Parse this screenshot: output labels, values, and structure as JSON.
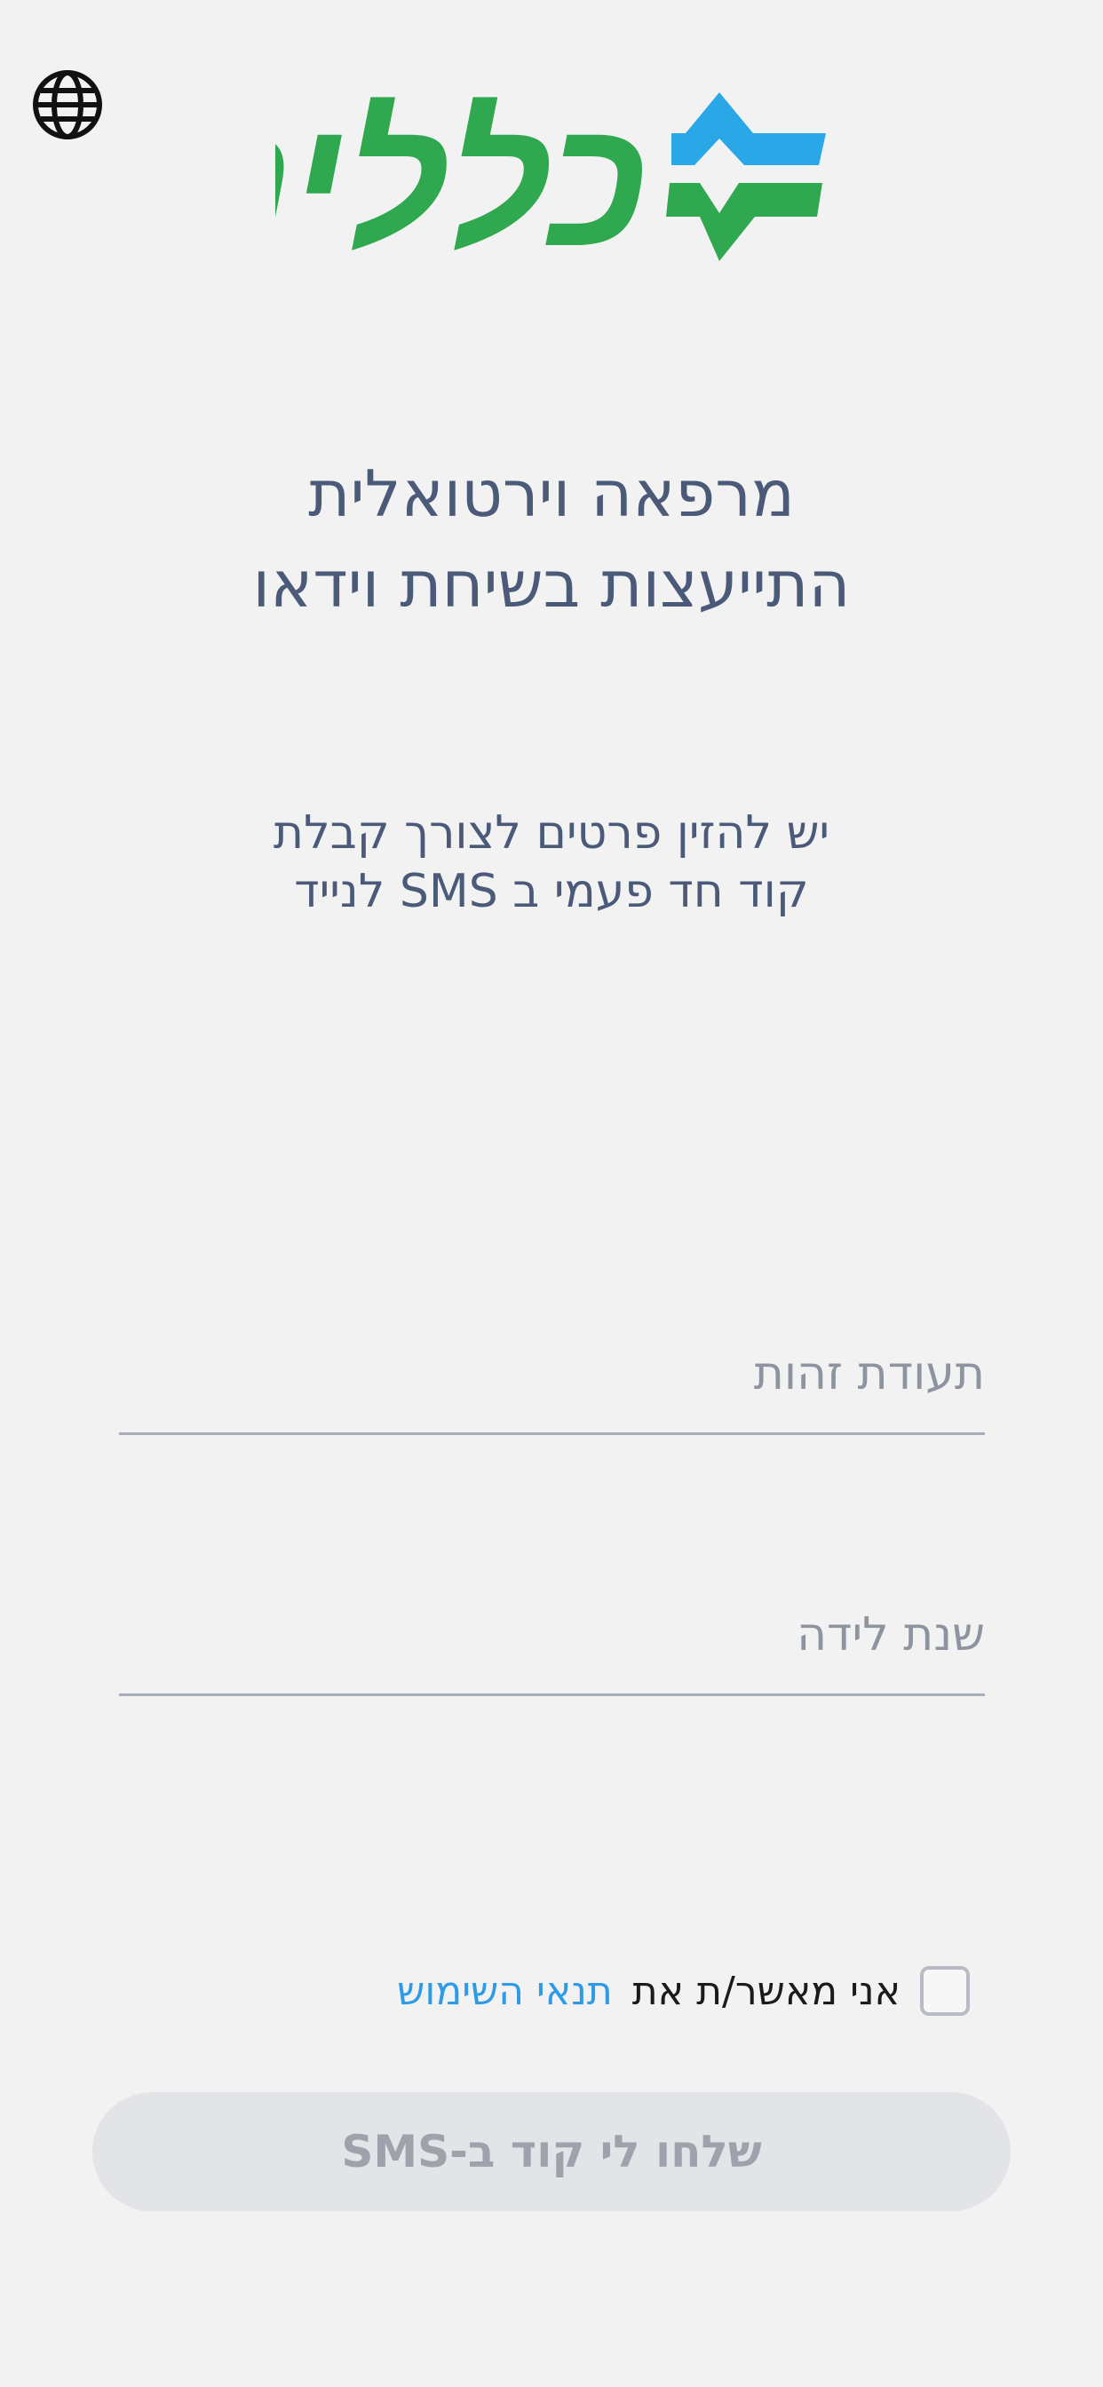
{
  "header": {
    "language_icon": "globe-icon",
    "logo_text": "כללית",
    "logo_colors": {
      "text": "#2fa84f",
      "mark_top": "#2aa7e6",
      "mark_bottom": "#2fa84f"
    }
  },
  "main": {
    "title_line1": "מרפאה וירטואלית",
    "title_line2": "התייעצות בשיחת וידאו",
    "subtitle_line1": "יש להזין פרטים לצורך קבלת",
    "subtitle_line2": "קוד חד פעמי ב SMS לנייד"
  },
  "form": {
    "id_field": {
      "placeholder": "תעודת זהות",
      "value": ""
    },
    "birth_year_field": {
      "placeholder": "שנת לידה",
      "value": ""
    },
    "terms": {
      "checked": false,
      "text": "אני מאשר/ת את",
      "link": "תנאי השימוש"
    },
    "submit_label": "שלחו לי קוד ב-SMS"
  },
  "colors": {
    "background": "#f2f2f2",
    "text_primary": "#4b5a78",
    "link": "#2f9ae6",
    "button_bg": "#e3e4e7",
    "button_text": "#9ea3ab"
  }
}
